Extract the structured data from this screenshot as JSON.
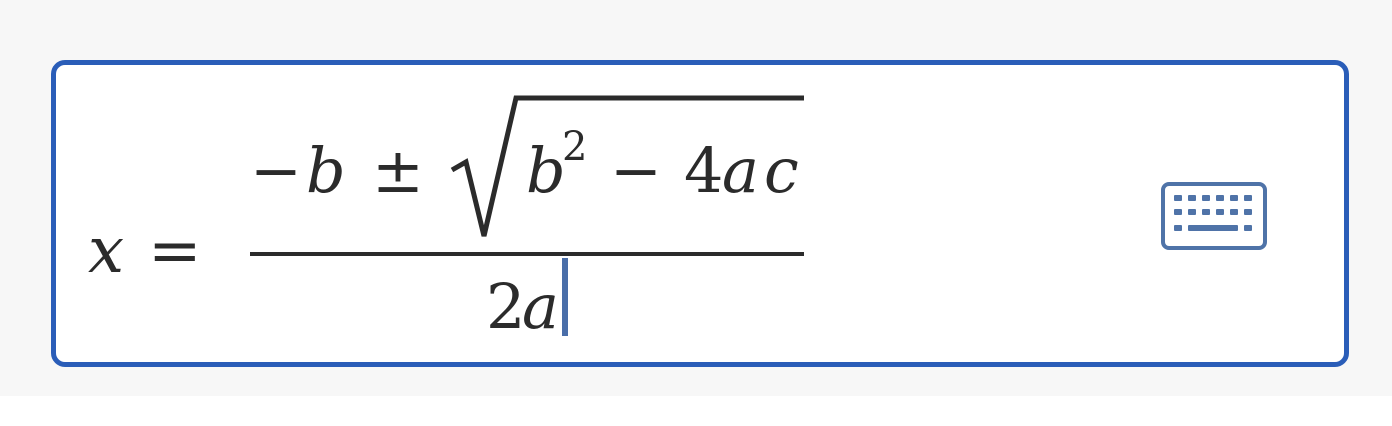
{
  "math_field": {
    "lhs": {
      "variable": "x",
      "equals": "="
    },
    "numerator": {
      "minus": "−",
      "b": "b",
      "plus_minus": "±",
      "radicand_b": "b",
      "exponent": "2",
      "minus2": "−",
      "coeff": "4",
      "a": "a",
      "c": "c"
    },
    "denominator": {
      "coeff": "2",
      "a": "a"
    },
    "keyboard_toggle": {
      "icon": "keyboard-icon"
    }
  },
  "colors": {
    "focus_border": "#2a5db8",
    "caret": "#4a6ea9",
    "keyboard_icon": "#4f73a8",
    "text": "#2b2b2b",
    "backdrop": "#f7f7f7"
  }
}
